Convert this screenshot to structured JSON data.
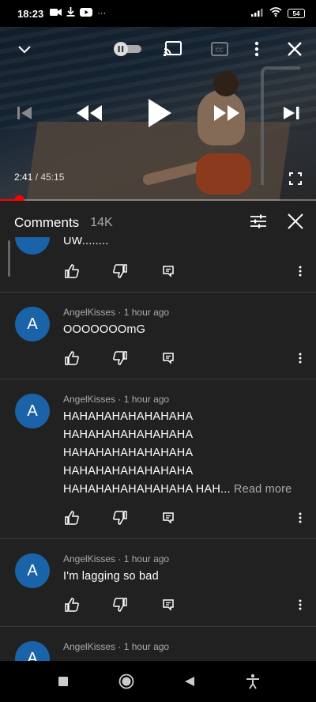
{
  "status_bar": {
    "time": "18:23",
    "battery": "54",
    "left_icons": [
      "video-camera-icon",
      "download-icon",
      "youtube-icon",
      "more-dots-icon"
    ],
    "right_icons": [
      "signal-icon",
      "wifi-icon",
      "battery-icon"
    ]
  },
  "player": {
    "current_time": "2:41",
    "separator": " / ",
    "duration": "45:15",
    "progress_fraction": 0.059,
    "accent_color": "#ff0000"
  },
  "comments_header": {
    "title": "Comments",
    "count": "14K"
  },
  "comments": [
    {
      "avatar_letter": "",
      "author": "",
      "time": "",
      "text": "UW........",
      "partial": true
    },
    {
      "avatar_letter": "A",
      "author": "AngelKisses",
      "time": "1 hour ago",
      "lines": [
        "OOOOOOOmG"
      ]
    },
    {
      "avatar_letter": "A",
      "author": "AngelKisses",
      "time": "1 hour ago",
      "lines": [
        "HAHAHAHAHAHAHAHA",
        "HAHAHAHAHAHAHAHA",
        "HAHAHAHAHAHAHAHA",
        "HAHAHAHAHAHAHAHA",
        "HAHAHAHAHAHAHAHA HAH..."
      ],
      "read_more": "Read more"
    },
    {
      "avatar_letter": "A",
      "author": "AngelKisses",
      "time": "1 hour ago",
      "lines": [
        "I'm lagging so bad"
      ]
    },
    {
      "avatar_letter": "A",
      "author": "AngelKisses",
      "time": "1 hour ago",
      "lines": []
    }
  ],
  "meta_separator": " · ",
  "colors": {
    "background": "#212121",
    "avatar": "#1a63a8",
    "secondary_text": "#aaaaaa"
  }
}
